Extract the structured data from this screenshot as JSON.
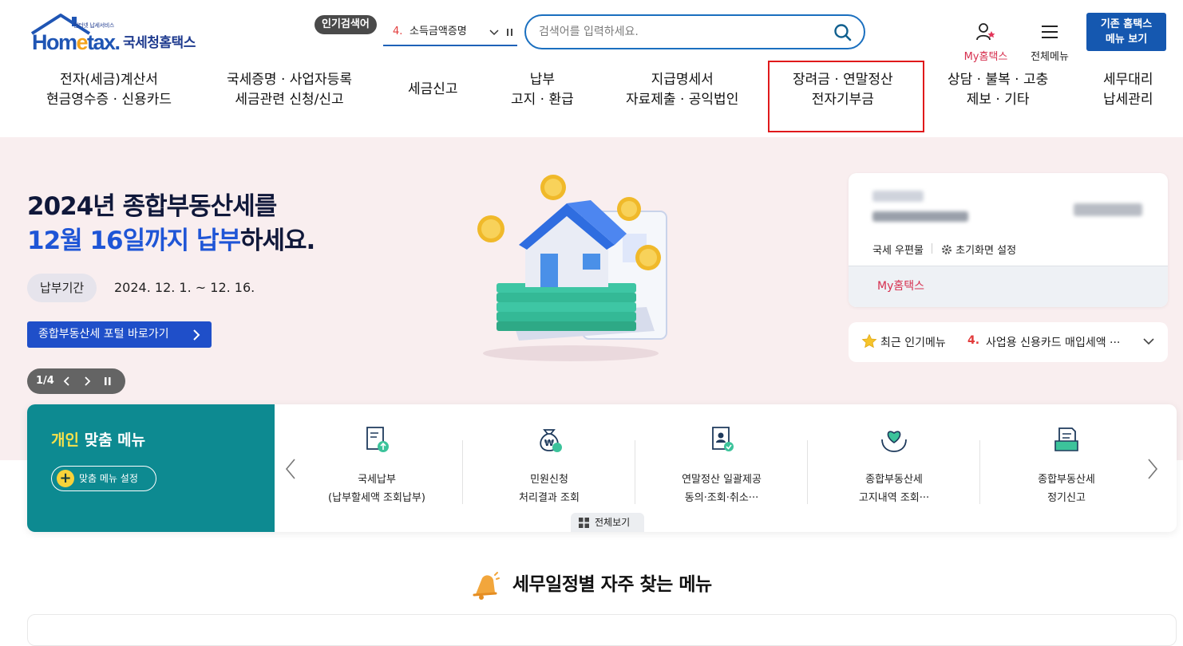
{
  "header": {
    "logo_small": "인터넷 납세서비스",
    "logo_word_a": "Hom",
    "logo_word_e": "e",
    "logo_word_b": "tax.",
    "logo_kr": "국세청홈택스",
    "popular_badge": "인기검색어",
    "popular_rank": "4.",
    "popular_text": "소득금액증명",
    "search_placeholder": "검색어를 입력하세요.",
    "my_hometax": "My홈택스",
    "all_menu": "전체메뉴",
    "old_menu_line1": "기존 홈택스",
    "old_menu_line2": "메뉴 보기"
  },
  "gnb": [
    {
      "line1": "전자(세금)계산서",
      "line2": "현금영수증 · 신용카드"
    },
    {
      "line1": "국세증명 · 사업자등록",
      "line2": "세금관련 신청/신고"
    },
    {
      "line1": "세금신고",
      "line2": ""
    },
    {
      "line1": "납부",
      "line2": "고지 · 환급"
    },
    {
      "line1": "지급명세서",
      "line2": "자료제출 · 공익법인"
    },
    {
      "line1": "장려금 · 연말정산",
      "line2": "전자기부금"
    },
    {
      "line1": "상담 · 불복 · 고충",
      "line2": "제보 · 기타"
    },
    {
      "line1": "세무대리",
      "line2": "납세관리"
    }
  ],
  "hero": {
    "title_line1": "2024년 종합부동산세를",
    "title_line2_blue": "12월 16일까지 납부",
    "title_line2_rest": "하세요.",
    "period_label": "납부기간",
    "period_value": "2024. 12. 1. ~ 12. 16.",
    "portal_button": "종합부동산세 포털 바로가기",
    "slide_counter": "1/4"
  },
  "user_card": {
    "mailbox": "국세 우편물",
    "home_setting": "초기화면 설정",
    "my_link": "My홈택스"
  },
  "recent": {
    "label": "최근 인기메뉴",
    "rank": "4.",
    "value": "사업용 신용카드 매입세액 ···"
  },
  "custom_menu": {
    "title_yellow": "개인",
    "title_rest": " 맞춤 메뉴",
    "setting_button": "맞춤 메뉴 설정",
    "items": [
      {
        "line1": "국세납부",
        "line2": "(납부할세액 조회납부)",
        "icon": "tax-payment-icon"
      },
      {
        "line1": "민원신청",
        "line2": "처리결과 조회",
        "icon": "money-bag-icon"
      },
      {
        "line1": "연말정산 일괄제공",
        "line2": "동의·조회·취소···",
        "icon": "document-person-icon"
      },
      {
        "line1": "종합부동산세",
        "line2": "고지내역 조회···",
        "icon": "heart-hands-icon"
      },
      {
        "line1": "종합부동산세",
        "line2": "정기신고",
        "icon": "report-form-icon"
      }
    ],
    "view_all": "전체보기"
  },
  "section": {
    "title": "세무일정별 자주 찾는 메뉴"
  },
  "colors": {
    "brand_blue": "#1558b0",
    "highlight_red": "#e0191b",
    "teal": "#0d8a91",
    "hero_bg": "#f9eeef"
  }
}
